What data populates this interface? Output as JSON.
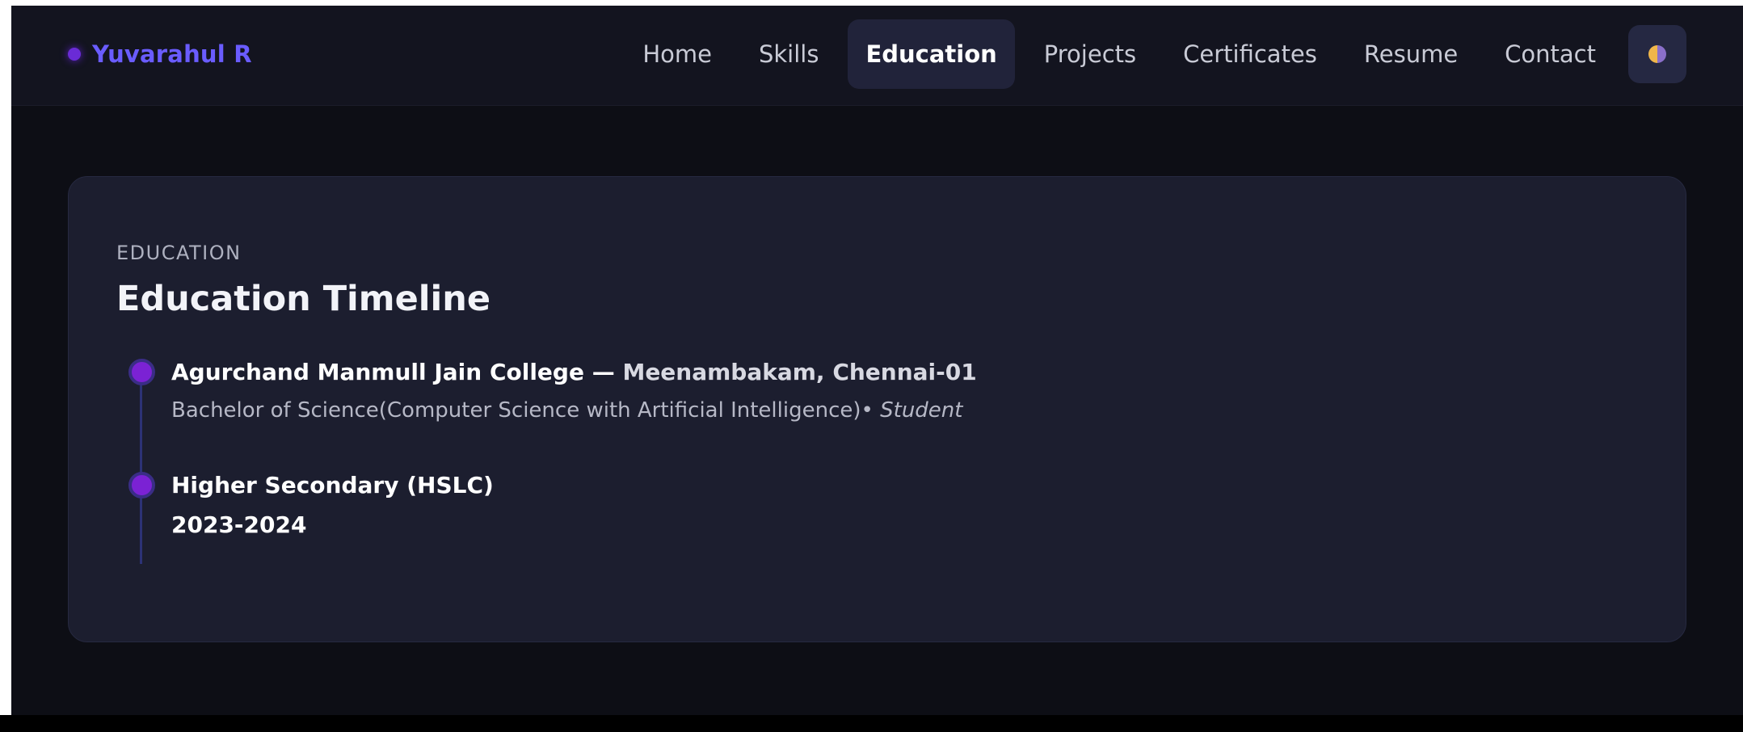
{
  "brand": {
    "name": "Yuvarahul R"
  },
  "nav": {
    "items": [
      {
        "label": "Home",
        "active": false
      },
      {
        "label": "Skills",
        "active": false
      },
      {
        "label": "Education",
        "active": true
      },
      {
        "label": "Projects",
        "active": false
      },
      {
        "label": "Certificates",
        "active": false
      },
      {
        "label": "Resume",
        "active": false
      },
      {
        "label": "Contact",
        "active": false
      }
    ],
    "theme_toggle_icon": "theme-toggle-icon"
  },
  "education": {
    "eyebrow": "EDUCATION",
    "title": "Education Timeline",
    "items": [
      {
        "institution": "Agurchand Manmull Jain College",
        "separator": " — ",
        "location": "Meenambakam, Chennai-01",
        "degree": "Bachelor of Science(Computer Science with Artificial Intelligence)",
        "bullet": "• ",
        "role": "Student"
      },
      {
        "institution": "Higher Secondary (HSLC)",
        "years": "2023-2024"
      }
    ]
  },
  "colors": {
    "brand_accent": "#6a5cff",
    "timeline_dot": "#7b22d4",
    "card_bg": "#1c1e2f",
    "nav_bg": "#13141f"
  }
}
